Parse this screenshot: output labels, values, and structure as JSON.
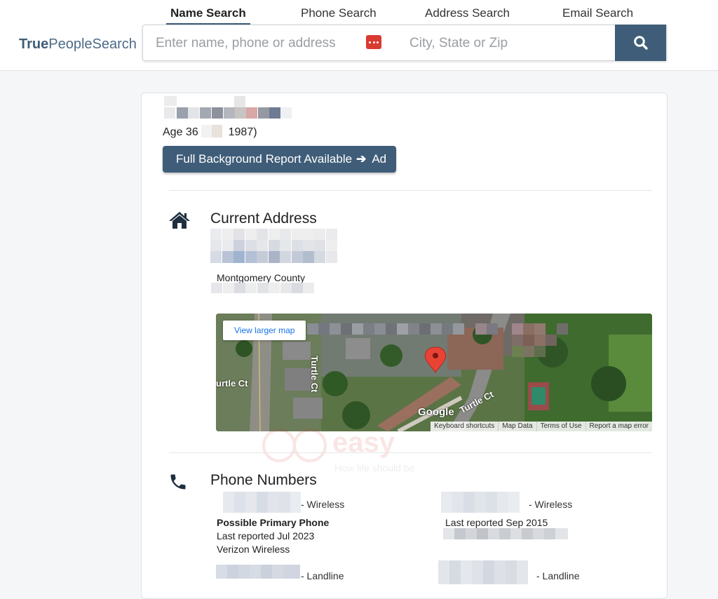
{
  "header": {
    "logo_bold": "True",
    "logo_rest": "PeopleSearch",
    "tabs": [
      "Name Search",
      "Phone Search",
      "Address Search",
      "Email Search"
    ],
    "search": {
      "name_placeholder": "Enter name, phone or address",
      "city_placeholder": "City, State or Zip"
    }
  },
  "person": {
    "age_prefix": "Age 36",
    "age_suffix": "1987)",
    "report_button": "Full Background Report Available",
    "report_suffix": "Ad"
  },
  "address": {
    "title": "Current Address",
    "county": "Montgomery County"
  },
  "map": {
    "larger_link": "View larger map",
    "brand": "Google",
    "streets": [
      "Turtle Ct",
      "urtle Ct",
      "Turtle Ct"
    ],
    "footer": [
      "Keyboard shortcuts",
      "Map Data",
      "Terms of Use",
      "Report a map error"
    ]
  },
  "phones": {
    "title": "Phone Numbers",
    "entries": [
      {
        "type": "- Wireless",
        "primary": "Possible Primary Phone",
        "reported": "Last reported Jul 2023",
        "carrier": "Verizon Wireless"
      },
      {
        "type": "- Wireless",
        "reported": "Last reported Sep 2015"
      },
      {
        "type": "- Landline"
      },
      {
        "type": "- Landline"
      }
    ]
  },
  "watermark": {
    "brand": "easy",
    "tagline": "How life should be"
  },
  "colors": {
    "primary": "#3f5d78",
    "accent_red": "#d93a32"
  }
}
